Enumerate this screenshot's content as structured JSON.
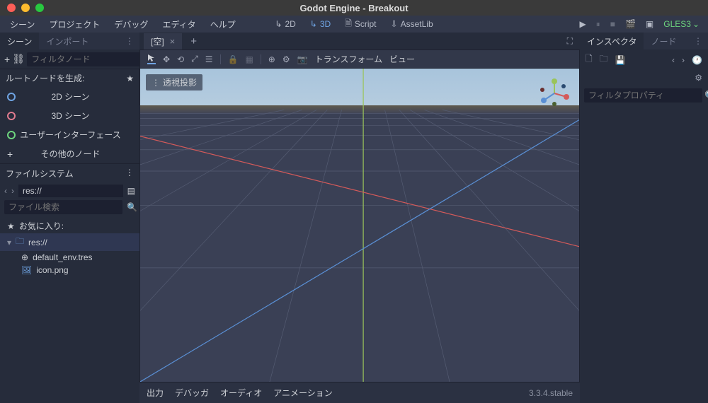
{
  "titlebar": {
    "title": "Godot Engine - Breakout"
  },
  "menubar": {
    "items": [
      "シーン",
      "プロジェクト",
      "デバッグ",
      "エディタ",
      "ヘルプ"
    ],
    "modes": {
      "m2d": "2D",
      "m3d": "3D",
      "script": "Script",
      "assetlib": "AssetLib"
    },
    "renderer": "GLES3"
  },
  "scene_panel": {
    "tabs": {
      "scene": "シーン",
      "import": "インポート"
    },
    "filter_placeholder": "フィルタノード",
    "root_label": "ルートノードを生成:",
    "roots": {
      "r2d": "2D シーン",
      "r3d": "3D シーン",
      "ui": "ユーザーインターフェース",
      "other": "その他のノード"
    }
  },
  "filesystem": {
    "title": "ファイルシステム",
    "path": "res://",
    "search_placeholder": "ファイル検索",
    "favorites": "お気に入り:",
    "root": "res://",
    "files": {
      "env": "default_env.tres",
      "icon": "icon.png"
    }
  },
  "center": {
    "tab": "[空]",
    "perspective": "透視投影",
    "transform": "トランスフォーム",
    "view": "ビュー"
  },
  "bottom": {
    "output": "出力",
    "debugger": "デバッガ",
    "audio": "オーディオ",
    "anim": "アニメーション",
    "version": "3.3.4.stable"
  },
  "inspector": {
    "tabs": {
      "inspector": "インスペクタ",
      "node": "ノード"
    },
    "filter_placeholder": "フィルタプロパティ"
  }
}
